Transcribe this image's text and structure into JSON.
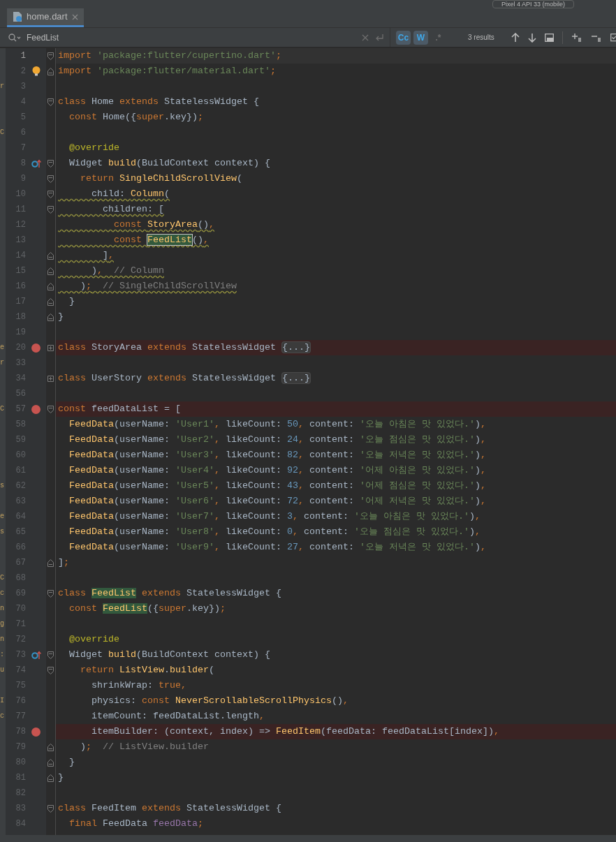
{
  "toolbar": {
    "device_selector": "Pixel 4 API 33 (mobile)"
  },
  "tabs": [
    {
      "label": "home.dart",
      "selected": true
    }
  ],
  "find_bar": {
    "query": "FeedList",
    "results": "3 results",
    "toggles": [
      {
        "label": "Cc",
        "on": true
      },
      {
        "label": "W",
        "on": true
      },
      {
        "label": ".*",
        "on": false
      }
    ]
  },
  "editor": {
    "lines": [
      {
        "number": "1",
        "current": true,
        "fold": {
          "kind": "start"
        },
        "t": [
          {
            "kind": "keyword",
            "text": "import "
          },
          {
            "kind": "string",
            "text": "'package:flutter/cupertino.dart'"
          },
          {
            "kind": "keyword",
            "text": ";"
          }
        ]
      },
      {
        "number": "2",
        "fold": {
          "kind": "end"
        },
        "gutter_icon": {
          "kind": "bulb"
        },
        "t": [
          {
            "kind": "keyword",
            "text": "import "
          },
          {
            "kind": "string",
            "text": "'package:flutter/material.dart'"
          },
          {
            "kind": "keyword",
            "text": ";"
          }
        ]
      },
      {
        "number": "3",
        "side": "r"
      },
      {
        "number": "4",
        "fold": {
          "kind": "start"
        },
        "t": [
          {
            "kind": "keyword",
            "text": "class "
          },
          {
            "kind": "plain",
            "text": "Home "
          },
          {
            "kind": "keyword",
            "text": "extends "
          },
          {
            "kind": "plain",
            "text": "StatelessWidget {"
          }
        ]
      },
      {
        "number": "5",
        "t": [
          {
            "kind": "keyword",
            "text": "  const "
          },
          {
            "kind": "plain",
            "text": "Home({"
          },
          {
            "kind": "keyword",
            "text": "super"
          },
          {
            "kind": "plain",
            "text": ".key})"
          },
          {
            "kind": "keyword",
            "text": ";"
          }
        ]
      },
      {
        "number": "6",
        "side": "C"
      },
      {
        "number": "7",
        "t": [
          {
            "kind": "annotation",
            "text": "  @override"
          }
        ]
      },
      {
        "number": "8",
        "fold": {
          "kind": "start"
        },
        "gutter_icon": {
          "kind": "override"
        },
        "t": [
          {
            "kind": "plain",
            "text": "  Widget "
          },
          {
            "kind": "type",
            "text": "build"
          },
          {
            "kind": "plain",
            "text": "(BuildContext context) {"
          }
        ]
      },
      {
        "number": "9",
        "fold": {
          "kind": "start"
        },
        "t": [
          {
            "kind": "keyword",
            "text": "    return "
          },
          {
            "kind": "type",
            "text": "SingleChildScrollView"
          },
          {
            "kind": "plain",
            "text": "("
          }
        ]
      },
      {
        "number": "10",
        "fold": {
          "kind": "start"
        },
        "warning": true,
        "t": [
          {
            "kind": "plain",
            "text": "      child: "
          },
          {
            "kind": "type",
            "text": "Column"
          },
          {
            "kind": "plain",
            "text": "("
          }
        ]
      },
      {
        "number": "11",
        "fold": {
          "kind": "start"
        },
        "warning": true,
        "t": [
          {
            "kind": "plain",
            "text": "        children: ["
          }
        ]
      },
      {
        "number": "12",
        "warning": true,
        "t": [
          {
            "kind": "keyword",
            "text": "          const "
          },
          {
            "kind": "type",
            "text": "StoryArea"
          },
          {
            "kind": "plain",
            "text": "()"
          },
          {
            "kind": "keyword",
            "text": ","
          }
        ]
      },
      {
        "number": "13",
        "warning": true,
        "t": [
          {
            "kind": "keyword",
            "text": "          const "
          },
          {
            "kind": "current_match",
            "text": "FeedList"
          },
          {
            "kind": "plain",
            "text": "()"
          },
          {
            "kind": "keyword",
            "text": ","
          }
        ]
      },
      {
        "number": "14",
        "fold": {
          "kind": "end"
        },
        "warning": true,
        "t": [
          {
            "kind": "plain",
            "text": "        ]"
          },
          {
            "kind": "keyword",
            "text": ","
          }
        ]
      },
      {
        "number": "15",
        "fold": {
          "kind": "end"
        },
        "warning": true,
        "t": [
          {
            "kind": "plain",
            "text": "      )"
          },
          {
            "kind": "keyword",
            "text": ","
          },
          {
            "kind": "comment",
            "text": "  // Column"
          }
        ]
      },
      {
        "number": "16",
        "fold": {
          "kind": "end"
        },
        "warning": true,
        "t": [
          {
            "kind": "plain",
            "text": "    )"
          },
          {
            "kind": "keyword",
            "text": ";"
          },
          {
            "kind": "comment",
            "text": "  // SingleChildScrollView"
          }
        ]
      },
      {
        "number": "17",
        "fold": {
          "kind": "end"
        },
        "t": [
          {
            "kind": "plain",
            "text": "  }"
          }
        ]
      },
      {
        "number": "18",
        "fold": {
          "kind": "end"
        },
        "t": [
          {
            "kind": "plain",
            "text": "}"
          }
        ]
      },
      {
        "number": "19"
      },
      {
        "number": "20",
        "fold": {
          "kind": "collapsed"
        },
        "gutter_icon": {
          "kind": "breakpoint"
        },
        "side": "e",
        "t": [
          {
            "kind": "keyword",
            "text": "class "
          },
          {
            "kind": "plain",
            "text": "StoryArea "
          },
          {
            "kind": "keyword",
            "text": "extends "
          },
          {
            "kind": "plain",
            "text": "StatelessWidget "
          },
          {
            "kind": "folded",
            "text": "{...}"
          }
        ]
      },
      {
        "number": "33",
        "side": "r"
      },
      {
        "number": "34",
        "fold": {
          "kind": "collapsed"
        },
        "t": [
          {
            "kind": "keyword",
            "text": "class "
          },
          {
            "kind": "plain",
            "text": "UserStory "
          },
          {
            "kind": "keyword",
            "text": "extends "
          },
          {
            "kind": "plain",
            "text": "StatelessWidget "
          },
          {
            "kind": "folded",
            "text": "{...}"
          }
        ]
      },
      {
        "number": "56"
      },
      {
        "number": "57",
        "fold": {
          "kind": "start"
        },
        "gutter_icon": {
          "kind": "breakpoint"
        },
        "side": "C",
        "t": [
          {
            "kind": "keyword",
            "text": "const "
          },
          {
            "kind": "plain",
            "text": "feedDataList = ["
          }
        ]
      },
      {
        "number": "58",
        "t": [
          {
            "kind": "type",
            "text": "  FeedData"
          },
          {
            "kind": "plain",
            "text": "(userName: "
          },
          {
            "kind": "string",
            "text": "'User1'"
          },
          {
            "kind": "keyword",
            "text": ","
          },
          {
            "kind": "plain",
            "text": " likeCount: "
          },
          {
            "kind": "number",
            "text": "50"
          },
          {
            "kind": "keyword",
            "text": ","
          },
          {
            "kind": "plain",
            "text": " content: "
          },
          {
            "kind": "string",
            "text": "'오늘 아침은 맛 있었다.'"
          },
          {
            "kind": "plain",
            "text": ")"
          },
          {
            "kind": "keyword",
            "text": ","
          }
        ]
      },
      {
        "number": "59",
        "t": [
          {
            "kind": "type",
            "text": "  FeedData"
          },
          {
            "kind": "plain",
            "text": "(userName: "
          },
          {
            "kind": "string",
            "text": "'User2'"
          },
          {
            "kind": "keyword",
            "text": ","
          },
          {
            "kind": "plain",
            "text": " likeCount: "
          },
          {
            "kind": "number",
            "text": "24"
          },
          {
            "kind": "keyword",
            "text": ","
          },
          {
            "kind": "plain",
            "text": " content: "
          },
          {
            "kind": "string",
            "text": "'오늘 점심은 맛 있었다.'"
          },
          {
            "kind": "plain",
            "text": ")"
          },
          {
            "kind": "keyword",
            "text": ","
          }
        ]
      },
      {
        "number": "60",
        "t": [
          {
            "kind": "type",
            "text": "  FeedData"
          },
          {
            "kind": "plain",
            "text": "(userName: "
          },
          {
            "kind": "string",
            "text": "'User3'"
          },
          {
            "kind": "keyword",
            "text": ","
          },
          {
            "kind": "plain",
            "text": " likeCount: "
          },
          {
            "kind": "number",
            "text": "82"
          },
          {
            "kind": "keyword",
            "text": ","
          },
          {
            "kind": "plain",
            "text": " content: "
          },
          {
            "kind": "string",
            "text": "'오늘 저녁은 맛 있었다.'"
          },
          {
            "kind": "plain",
            "text": ")"
          },
          {
            "kind": "keyword",
            "text": ","
          }
        ]
      },
      {
        "number": "61",
        "t": [
          {
            "kind": "type",
            "text": "  FeedData"
          },
          {
            "kind": "plain",
            "text": "(userName: "
          },
          {
            "kind": "string",
            "text": "'User4'"
          },
          {
            "kind": "keyword",
            "text": ","
          },
          {
            "kind": "plain",
            "text": " likeCount: "
          },
          {
            "kind": "number",
            "text": "92"
          },
          {
            "kind": "keyword",
            "text": ","
          },
          {
            "kind": "plain",
            "text": " content: "
          },
          {
            "kind": "string",
            "text": "'어제 아침은 맛 있었다.'"
          },
          {
            "kind": "plain",
            "text": ")"
          },
          {
            "kind": "keyword",
            "text": ","
          }
        ]
      },
      {
        "number": "62",
        "side": "s",
        "t": [
          {
            "kind": "type",
            "text": "  FeedData"
          },
          {
            "kind": "plain",
            "text": "(userName: "
          },
          {
            "kind": "string",
            "text": "'User5'"
          },
          {
            "kind": "keyword",
            "text": ","
          },
          {
            "kind": "plain",
            "text": " likeCount: "
          },
          {
            "kind": "number",
            "text": "43"
          },
          {
            "kind": "keyword",
            "text": ","
          },
          {
            "kind": "plain",
            "text": " content: "
          },
          {
            "kind": "string",
            "text": "'어제 점심은 맛 있었다.'"
          },
          {
            "kind": "plain",
            "text": ")"
          },
          {
            "kind": "keyword",
            "text": ","
          }
        ]
      },
      {
        "number": "63",
        "t": [
          {
            "kind": "type",
            "text": "  FeedData"
          },
          {
            "kind": "plain",
            "text": "(userName: "
          },
          {
            "kind": "string",
            "text": "'User6'"
          },
          {
            "kind": "keyword",
            "text": ","
          },
          {
            "kind": "plain",
            "text": " likeCount: "
          },
          {
            "kind": "number",
            "text": "72"
          },
          {
            "kind": "keyword",
            "text": ","
          },
          {
            "kind": "plain",
            "text": " content: "
          },
          {
            "kind": "string",
            "text": "'어제 저녁은 맛 있었다.'"
          },
          {
            "kind": "plain",
            "text": ")"
          },
          {
            "kind": "keyword",
            "text": ","
          }
        ]
      },
      {
        "number": "64",
        "side": "e",
        "t": [
          {
            "kind": "type",
            "text": "  FeedData"
          },
          {
            "kind": "plain",
            "text": "(userName: "
          },
          {
            "kind": "string",
            "text": "'User7'"
          },
          {
            "kind": "keyword",
            "text": ","
          },
          {
            "kind": "plain",
            "text": " likeCount: "
          },
          {
            "kind": "number",
            "text": "3"
          },
          {
            "kind": "keyword",
            "text": ","
          },
          {
            "kind": "plain",
            "text": " content: "
          },
          {
            "kind": "string",
            "text": "'오늘 아침은 맛 있었다.'"
          },
          {
            "kind": "plain",
            "text": ")"
          },
          {
            "kind": "keyword",
            "text": ","
          }
        ]
      },
      {
        "number": "65",
        "side": "s",
        "t": [
          {
            "kind": "type",
            "text": "  FeedData"
          },
          {
            "kind": "plain",
            "text": "(userName: "
          },
          {
            "kind": "string",
            "text": "'User8'"
          },
          {
            "kind": "keyword",
            "text": ","
          },
          {
            "kind": "plain",
            "text": " likeCount: "
          },
          {
            "kind": "number",
            "text": "0"
          },
          {
            "kind": "keyword",
            "text": ","
          },
          {
            "kind": "plain",
            "text": " content: "
          },
          {
            "kind": "string",
            "text": "'오늘 점심은 맛 있었다.'"
          },
          {
            "kind": "plain",
            "text": ")"
          },
          {
            "kind": "keyword",
            "text": ","
          }
        ]
      },
      {
        "number": "66",
        "t": [
          {
            "kind": "type",
            "text": "  FeedData"
          },
          {
            "kind": "plain",
            "text": "(userName: "
          },
          {
            "kind": "string",
            "text": "'User9'"
          },
          {
            "kind": "keyword",
            "text": ","
          },
          {
            "kind": "plain",
            "text": " likeCount: "
          },
          {
            "kind": "number",
            "text": "27"
          },
          {
            "kind": "keyword",
            "text": ","
          },
          {
            "kind": "plain",
            "text": " content: "
          },
          {
            "kind": "string",
            "text": "'오늘 저녁은 맛 있었다.'"
          },
          {
            "kind": "plain",
            "text": ")"
          },
          {
            "kind": "keyword",
            "text": ","
          }
        ]
      },
      {
        "number": "67",
        "fold": {
          "kind": "end"
        },
        "t": [
          {
            "kind": "plain",
            "text": "]"
          },
          {
            "kind": "keyword",
            "text": ";"
          }
        ]
      },
      {
        "number": "68",
        "side": "C"
      },
      {
        "number": "69",
        "fold": {
          "kind": "start"
        },
        "side": "c",
        "t": [
          {
            "kind": "keyword",
            "text": "class "
          },
          {
            "kind": "match",
            "text": "FeedList"
          },
          {
            "kind": "keyword",
            "text": " extends "
          },
          {
            "kind": "plain",
            "text": "StatelessWidget {"
          }
        ]
      },
      {
        "number": "70",
        "side": "n",
        "t": [
          {
            "kind": "keyword",
            "text": "  const "
          },
          {
            "kind": "match",
            "text": "FeedList"
          },
          {
            "kind": "plain",
            "text": "({"
          },
          {
            "kind": "keyword",
            "text": "super"
          },
          {
            "kind": "plain",
            "text": ".key})"
          },
          {
            "kind": "keyword",
            "text": ";"
          }
        ]
      },
      {
        "number": "71",
        "side": "g"
      },
      {
        "number": "72",
        "side": "n",
        "t": [
          {
            "kind": "annotation",
            "text": "  @override"
          }
        ]
      },
      {
        "number": "73",
        "fold": {
          "kind": "start"
        },
        "gutter_icon": {
          "kind": "override"
        },
        "side": ":",
        "t": [
          {
            "kind": "plain",
            "text": "  Widget "
          },
          {
            "kind": "type",
            "text": "build"
          },
          {
            "kind": "plain",
            "text": "(BuildContext context) {"
          }
        ]
      },
      {
        "number": "74",
        "fold": {
          "kind": "start"
        },
        "side": "u",
        "t": [
          {
            "kind": "keyword",
            "text": "    return "
          },
          {
            "kind": "type",
            "text": "ListView"
          },
          {
            "kind": "plain",
            "text": "."
          },
          {
            "kind": "type",
            "text": "builder"
          },
          {
            "kind": "plain",
            "text": "("
          }
        ]
      },
      {
        "number": "75",
        "t": [
          {
            "kind": "plain",
            "text": "      shrinkWrap: "
          },
          {
            "kind": "keyword",
            "text": "true,"
          }
        ]
      },
      {
        "number": "76",
        "side": "I",
        "t": [
          {
            "kind": "plain",
            "text": "      physics: "
          },
          {
            "kind": "keyword",
            "text": "const "
          },
          {
            "kind": "type",
            "text": "NeverScrollableScrollPhysics"
          },
          {
            "kind": "plain",
            "text": "()"
          },
          {
            "kind": "keyword",
            "text": ","
          }
        ]
      },
      {
        "number": "77",
        "side": "c",
        "t": [
          {
            "kind": "plain",
            "text": "      itemCount: feedDataList.length"
          },
          {
            "kind": "keyword",
            "text": ","
          }
        ]
      },
      {
        "number": "78",
        "gutter_icon": {
          "kind": "breakpoint"
        },
        "t": [
          {
            "kind": "plain",
            "text": "      itemBuilder: (context, index) => "
          },
          {
            "kind": "type",
            "text": "FeedItem"
          },
          {
            "kind": "plain",
            "text": "(feedData: feedDataList[index])"
          },
          {
            "kind": "keyword",
            "text": ","
          }
        ]
      },
      {
        "number": "79",
        "fold": {
          "kind": "end"
        },
        "t": [
          {
            "kind": "plain",
            "text": "    )"
          },
          {
            "kind": "keyword",
            "text": ";"
          },
          {
            "kind": "comment",
            "text": "  // ListView.builder"
          }
        ]
      },
      {
        "number": "80",
        "fold": {
          "kind": "end"
        },
        "t": [
          {
            "kind": "plain",
            "text": "  }"
          }
        ]
      },
      {
        "number": "81",
        "fold": {
          "kind": "end"
        },
        "t": [
          {
            "kind": "plain",
            "text": "}"
          }
        ]
      },
      {
        "number": "82"
      },
      {
        "number": "83",
        "fold": {
          "kind": "start"
        },
        "t": [
          {
            "kind": "keyword",
            "text": "class "
          },
          {
            "kind": "plain",
            "text": "FeedItem "
          },
          {
            "kind": "keyword",
            "text": "extends "
          },
          {
            "kind": "plain",
            "text": "StatelessWidget {"
          }
        ]
      },
      {
        "number": "84",
        "t": [
          {
            "kind": "keyword",
            "text": "  final "
          },
          {
            "kind": "plain",
            "text": "FeedData "
          },
          {
            "kind": "field",
            "text": "feedData"
          },
          {
            "kind": "keyword",
            "text": ";"
          }
        ]
      }
    ]
  }
}
